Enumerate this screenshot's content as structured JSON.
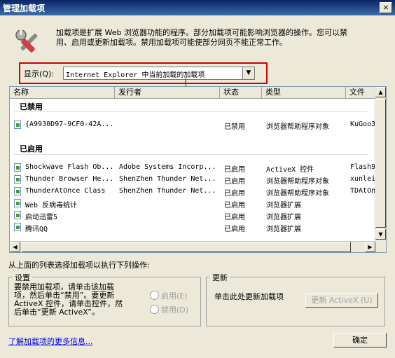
{
  "window": {
    "title": "管理加载项",
    "close_label": "×"
  },
  "intro_lines": [
    "加载项是扩展 Web 浏览器功能的程序。部分加载项可能影响浏览器的操作。您可以禁",
    "用、启用或更新加载项。禁用加载项可能使部分网页不能正常工作。"
  ],
  "show": {
    "label": "显示(Q):",
    "selected": "Internet Explorer 中当前加载的加载项"
  },
  "columns": [
    "名称",
    "发行者",
    "状态",
    "类型",
    "文件"
  ],
  "groups": [
    {
      "label": "已禁用",
      "rows": [
        {
          "name": "{A9930D97-9CF0-42A...",
          "publisher": "",
          "status": "已禁用",
          "type": "浏览器帮助程序对象",
          "file": "KuGoo3"
        }
      ]
    },
    {
      "label": "已启用",
      "rows": [
        {
          "name": "Shockwave Flash Ob...",
          "publisher": "Adobe Systems Incorp...",
          "status": "已启用",
          "type": "ActiveX 控件",
          "file": "Flash9"
        },
        {
          "name": "Thunder Browser He...",
          "publisher": "ShenZhen Thunder Net...",
          "status": "已启用",
          "type": "浏览器帮助程序对象",
          "file": "xunlei"
        },
        {
          "name": "ThunderAtOnce Class",
          "publisher": "ShenZhen Thunder Net...",
          "status": "已启用",
          "type": "浏览器帮助程序对象",
          "file": "TDAtOn"
        },
        {
          "name": "Web 反病毒统计",
          "publisher": "",
          "status": "已启用",
          "type": "浏览器扩展",
          "file": ""
        },
        {
          "name": "启动迅雷5",
          "publisher": "",
          "status": "已启用",
          "type": "浏览器扩展",
          "file": ""
        },
        {
          "name": "腾讯QQ",
          "publisher": "",
          "status": "已启用",
          "type": "浏览器扩展",
          "file": ""
        }
      ]
    }
  ],
  "instruction": "从上面的列表选择加载项以执行下列操作:",
  "settings": {
    "label": "设置",
    "text_lines": [
      "要禁用加载项，请单击该加载",
      "项，然后单击“禁用”。要更新",
      "ActiveX 控件，请单击控件，然",
      "后单击“更新 ActiveX”。"
    ],
    "enable_label": "启用(E)",
    "disable_label": "禁用(D)"
  },
  "update": {
    "label": "更新",
    "text": "单击此处更新加载项",
    "button_label": "更新 ActiveX (U)"
  },
  "more_info_link": "了解加载项的更多信息...",
  "ok_label": "确定",
  "annotation_color": "#d00000"
}
